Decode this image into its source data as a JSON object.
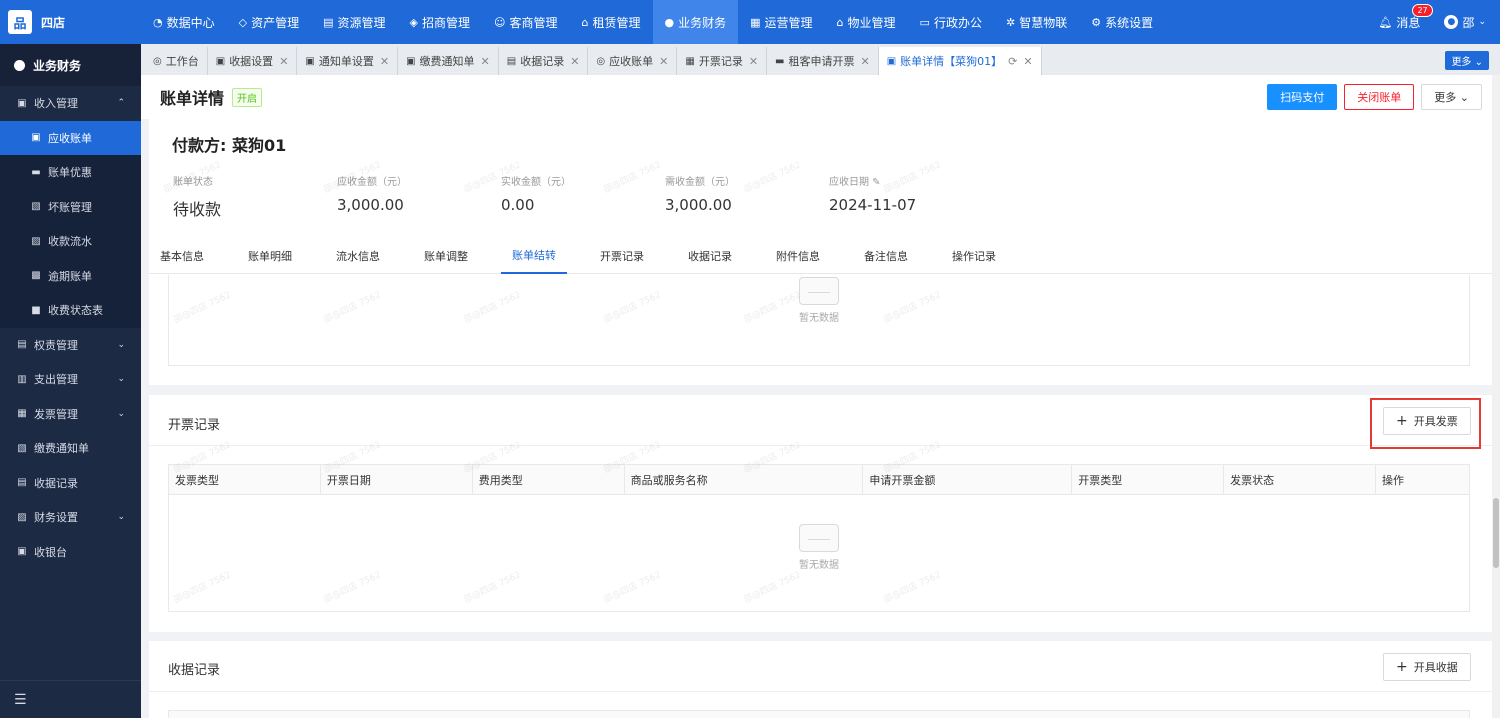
{
  "app": {
    "logo_glyph": "品",
    "name": "四店"
  },
  "topnav": [
    {
      "icon": "◔",
      "label": "数据中心"
    },
    {
      "icon": "◇",
      "label": "资产管理"
    },
    {
      "icon": "▤",
      "label": "资源管理"
    },
    {
      "icon": "◈",
      "label": "招商管理"
    },
    {
      "icon": "☺",
      "label": "客商管理"
    },
    {
      "icon": "⌂",
      "label": "租赁管理"
    },
    {
      "icon": "●",
      "label": "业务财务",
      "active": true
    },
    {
      "icon": "▦",
      "label": "运营管理"
    },
    {
      "icon": "⌂",
      "label": "物业管理"
    },
    {
      "icon": "▭",
      "label": "行政办公"
    },
    {
      "icon": "✲",
      "label": "智慧物联"
    },
    {
      "icon": "⚙",
      "label": "系统设置"
    }
  ],
  "header_right": {
    "message_label": "消息",
    "message_count": "27",
    "user_name": "邵"
  },
  "sidebar": {
    "head": "业务财务",
    "items": [
      {
        "icon": "▣",
        "label": "收入管理",
        "chev": "⌃",
        "level": 0
      },
      {
        "icon": "▣",
        "label": "应收账单",
        "level": 1,
        "active": true
      },
      {
        "icon": "▬",
        "label": "账单优惠",
        "level": 1
      },
      {
        "icon": "▧",
        "label": "坏账管理",
        "level": 1
      },
      {
        "icon": "▨",
        "label": "收款流水",
        "level": 1
      },
      {
        "icon": "▩",
        "label": "逾期账单",
        "level": 1
      },
      {
        "icon": "■",
        "label": "收费状态表",
        "level": 1
      },
      {
        "icon": "▤",
        "label": "权责管理",
        "chev": "⌄",
        "level": 0
      },
      {
        "icon": "▥",
        "label": "支出管理",
        "chev": "⌄",
        "level": 0
      },
      {
        "icon": "▦",
        "label": "发票管理",
        "chev": "⌄",
        "level": 0
      },
      {
        "icon": "▧",
        "label": "缴费通知单",
        "level": 0
      },
      {
        "icon": "▤",
        "label": "收据记录",
        "level": 0
      },
      {
        "icon": "▨",
        "label": "财务设置",
        "chev": "⌄",
        "level": 0
      },
      {
        "icon": "▣",
        "label": "收银台",
        "level": 0
      }
    ],
    "footer_icon": "☰"
  },
  "tabs": [
    {
      "icon": "◎",
      "label": "工作台",
      "closable": false
    },
    {
      "icon": "▣",
      "label": "收据设置",
      "closable": true
    },
    {
      "icon": "▣",
      "label": "通知单设置",
      "closable": true
    },
    {
      "icon": "▣",
      "label": "缴费通知单",
      "closable": true
    },
    {
      "icon": "▤",
      "label": "收据记录",
      "closable": true
    },
    {
      "icon": "◎",
      "label": "应收账单",
      "closable": true
    },
    {
      "icon": "▦",
      "label": "开票记录",
      "closable": true
    },
    {
      "icon": "▬",
      "label": "租客申请开票",
      "closable": true
    },
    {
      "icon": "▣",
      "label": "账单详情【菜狗01】",
      "closable": true,
      "active": true
    }
  ],
  "tabs_more": "更多 ⌄",
  "page": {
    "title": "账单详情",
    "status": "开启",
    "buttons": {
      "scan_pay": "扫码支付",
      "close_bill": "关闭账单",
      "more": "更多 ⌄"
    },
    "payer": "付款方: 菜狗01",
    "stats": [
      {
        "label": "账单状态",
        "value": "待收款"
      },
      {
        "label": "应收金额（元）",
        "value": "3,000.00"
      },
      {
        "label": "实收金额（元）",
        "value": "0.00"
      },
      {
        "label": "需收金额（元）",
        "value": "3,000.00"
      },
      {
        "label": "应收日期 ✎",
        "value": "2024-11-07"
      }
    ],
    "detail_tabs": [
      "基本信息",
      "账单明细",
      "流水信息",
      "账单调整",
      "账单结转",
      "开票记录",
      "收据记录",
      "附件信息",
      "备注信息",
      "操作记录"
    ],
    "active_detail_tab": 4,
    "empty_text": "暂无数据",
    "invoice": {
      "title": "开票记录",
      "button": "开具发票",
      "columns": [
        "发票类型",
        "开票日期",
        "费用类型",
        "商品或服务名称",
        "申请开票金额",
        "开票类型",
        "发票状态",
        "操作"
      ]
    },
    "receipt": {
      "title": "收据记录",
      "button": "开具收据"
    }
  },
  "watermark": "邵@四店 7562",
  "colors": {
    "primary": "#1f6ad8",
    "sidebar_bg": "#1d2a44",
    "danger": "#f5222d",
    "highlight": "#e53935"
  }
}
